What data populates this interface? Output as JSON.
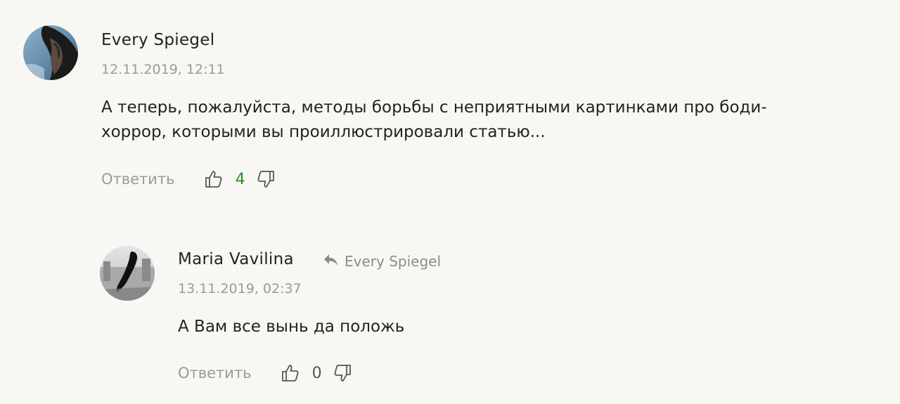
{
  "comments": [
    {
      "author": "Every Spiegel",
      "date": "12.11.2019, 12:11",
      "text_line1": "А теперь, пожалуйста, методы борьбы с неприятными картинками про боди-",
      "text_line2": "хоррор, которыми вы проиллюстрировали статью...",
      "reply_label": "Ответить",
      "likes": "4",
      "likes_color": "#2e8b2e"
    },
    {
      "author": "Maria Vavilina",
      "reply_to": "Every Spiegel",
      "date": "13.11.2019, 02:37",
      "text_line1": "А Вам все вынь да положь",
      "reply_label": "Ответить",
      "likes": "0",
      "likes_color": "#555555"
    }
  ]
}
